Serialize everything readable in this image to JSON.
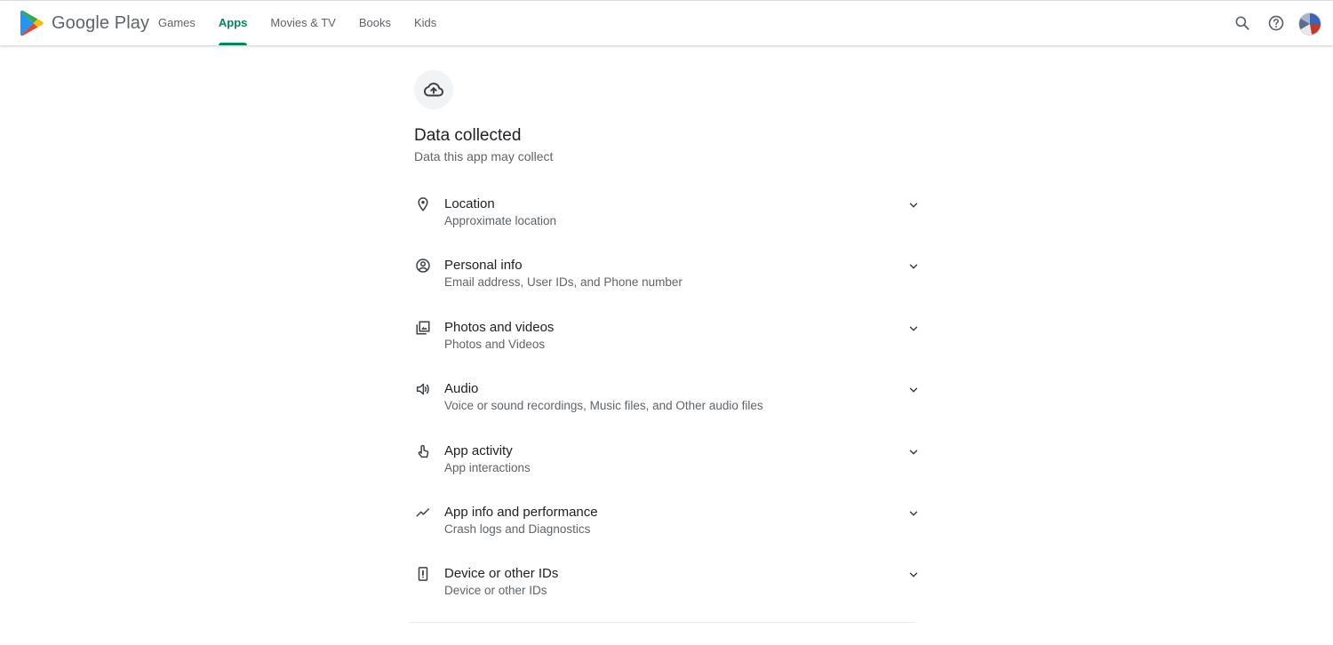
{
  "header": {
    "brand": "Google Play",
    "nav": [
      {
        "label": "Games",
        "active": false
      },
      {
        "label": "Apps",
        "active": true
      },
      {
        "label": "Movies & TV",
        "active": false
      },
      {
        "label": "Books",
        "active": false
      },
      {
        "label": "Kids",
        "active": false
      }
    ],
    "icons": [
      "search-icon",
      "help-icon",
      "account-avatar"
    ]
  },
  "section": {
    "icon": "cloud-upload-icon",
    "title": "Data collected",
    "subtitle": "Data this app may collect"
  },
  "items": [
    {
      "icon": "location-pin-icon",
      "title": "Location",
      "description": "Approximate location"
    },
    {
      "icon": "account-circle-icon",
      "title": "Personal info",
      "description": "Email address, User IDs, and Phone number"
    },
    {
      "icon": "photo-library-icon",
      "title": "Photos and videos",
      "description": "Photos and Videos"
    },
    {
      "icon": "volume-icon",
      "title": "Audio",
      "description": "Voice or sound recordings, Music files, and Other audio files"
    },
    {
      "icon": "touch-app-icon",
      "title": "App activity",
      "description": "App interactions"
    },
    {
      "icon": "analytics-icon",
      "title": "App info and performance",
      "description": "Crash logs and Diagnostics"
    },
    {
      "icon": "phone-device-icon",
      "title": "Device or other IDs",
      "description": "Device or other IDs"
    }
  ],
  "colors": {
    "accent": "#01875f",
    "text": "#202124",
    "secondary": "#5f6368"
  }
}
